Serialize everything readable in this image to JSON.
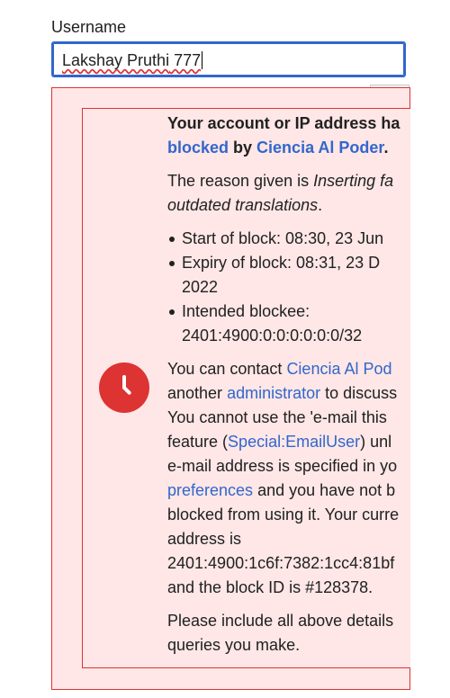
{
  "form": {
    "username_label": "Username",
    "username_value_a": "Lakshay Pruthi",
    "username_value_b": " 777"
  },
  "keyboard": {
    "icon": "keyboard-icon",
    "menu": "chevron-down-icon"
  },
  "block_notice": {
    "icon": "clock-icon",
    "title_1": "Your account or IP address ha",
    "title_link_blocked": "blocked",
    "title_by": " by ",
    "title_link_admin": "Ciencia Al Poder",
    "title_end": ".",
    "reason_prefix": "The reason given is ",
    "reason_italic_1": "Inserting fa",
    "reason_italic_2": "outdated translations",
    "reason_suffix": ".",
    "details": {
      "start": "Start of block: 08:30, 23 Jun",
      "expiry_1": "Expiry of block: 08:31, 23 D",
      "expiry_2": "2022",
      "blockee_1": "Intended blockee:",
      "blockee_2": "2401:4900:0:0:0:0:0:0/32"
    },
    "contact_1_prefix": "You can contact ",
    "contact_1_link": "Ciencia Al Pod",
    "contact_2_prefix": "another ",
    "contact_2_link": "administrator",
    "contact_2_suffix": " to discuss",
    "contact_3": "You cannot use the 'e-mail this",
    "contact_4_prefix": "feature (",
    "contact_4_link": "Special:EmailUser",
    "contact_4_suffix": ") unl",
    "contact_5": "e-mail address is specified in yo",
    "contact_6_link": "preferences",
    "contact_6_suffix": " and you have not b",
    "contact_7": "blocked from using it. Your curre",
    "contact_8": "address is",
    "contact_9": "2401:4900:1c6f:7382:1cc4:81bf",
    "contact_10": "and the block ID is #128378.",
    "footer_1": "Please include all above details",
    "footer_2": "queries you make."
  }
}
